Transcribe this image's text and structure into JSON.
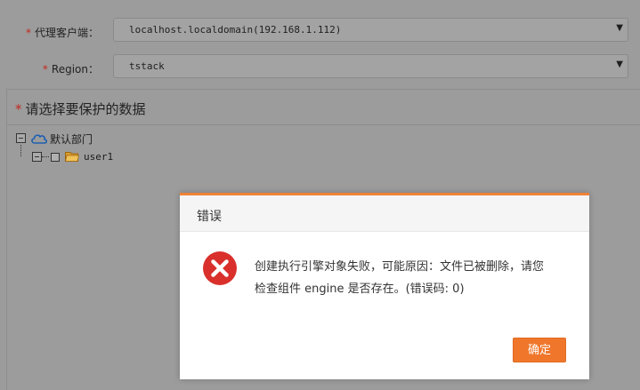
{
  "form": {
    "agent": {
      "required_mark": "*",
      "label": "代理客户端：",
      "value": "localhost.localdomain(192.168.1.112)",
      "arrow": "▼"
    },
    "region": {
      "required_mark": "*",
      "label": "Region：",
      "value": "tstack",
      "arrow": "▼"
    }
  },
  "panel": {
    "required_mark": "*",
    "title": "请选择要保护的数据",
    "tree": [
      {
        "label": "默认部门",
        "icon": "cloud-icon"
      },
      {
        "label": "user1",
        "icon": "folder-icon"
      }
    ]
  },
  "dialog": {
    "title": "错误",
    "icon": "error-x-icon",
    "message_line1": "创建执行引擎对象失败，可能原因：文件已被删除，请您",
    "message_line2": "检查组件 engine 是否存在。(错误码:   0)",
    "ok_label": "确定"
  },
  "colors": {
    "accent": "#f0762b",
    "error": "#d9302c",
    "required": "#c02a1d"
  }
}
